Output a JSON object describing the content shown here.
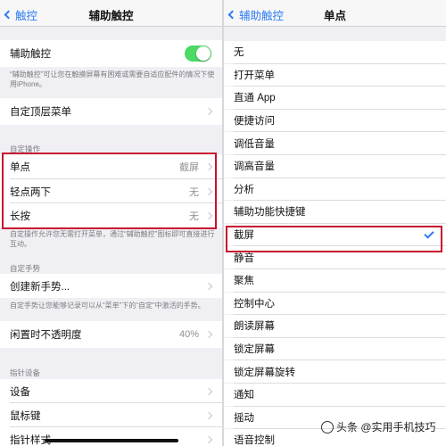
{
  "left": {
    "nav": {
      "back_label": "触控",
      "title": "辅助触控"
    },
    "assistive_touch": {
      "label": "辅助触控",
      "enabled": true
    },
    "assistive_touch_note": "“辅助触控”可让您在触摸屏幕有困难或需要自适应配件的情况下使用iPhone。",
    "top_menu": {
      "label": "自定顶层菜单"
    },
    "custom_actions_header": "自定操作",
    "actions": [
      {
        "label": "单点",
        "value": "截屏"
      },
      {
        "label": "轻点两下",
        "value": "无"
      },
      {
        "label": "长按",
        "value": "无"
      }
    ],
    "custom_actions_note": "自定操作允许您无需打开菜单，通过“辅助触控”图标即可直接进行互动。",
    "custom_gestures_header": "自定手势",
    "create_gesture": {
      "label": "创建新手势..."
    },
    "gesture_note": "自定手势让您能够记录可以从“菜单”下的“自定”中激活的手势。",
    "idle_opacity": {
      "label": "闲置时不透明度",
      "value": "40%"
    },
    "pointer_header": "指针设备",
    "pointer_items": [
      {
        "label": "设备"
      },
      {
        "label": "鼠标键"
      },
      {
        "label": "指针样式"
      }
    ]
  },
  "right": {
    "nav": {
      "back_label": "辅助触控",
      "title": "单点"
    },
    "options": [
      {
        "label": "无",
        "selected": false
      },
      {
        "label": "打开菜单",
        "selected": false
      },
      {
        "label": "直通 App",
        "selected": false
      },
      {
        "label": "便捷访问",
        "selected": false
      },
      {
        "label": "调低音量",
        "selected": false
      },
      {
        "label": "调高音量",
        "selected": false
      },
      {
        "label": "分析",
        "selected": false
      },
      {
        "label": "辅助功能快捷键",
        "selected": false
      },
      {
        "label": "截屏",
        "selected": true
      },
      {
        "label": "静音",
        "selected": false
      },
      {
        "label": "聚焦",
        "selected": false
      },
      {
        "label": "控制中心",
        "selected": false
      },
      {
        "label": "朗读屏幕",
        "selected": false
      },
      {
        "label": "锁定屏幕",
        "selected": false
      },
      {
        "label": "锁定屏幕旋转",
        "selected": false
      },
      {
        "label": "通知",
        "selected": false
      },
      {
        "label": "摇动",
        "selected": false
      },
      {
        "label": "语音控制",
        "selected": false
      }
    ]
  },
  "watermark": "头条 @实用手机技巧",
  "colors": {
    "accent": "#2d7cf6",
    "toggle_on": "#4cd964",
    "highlight": "#c8102e"
  }
}
